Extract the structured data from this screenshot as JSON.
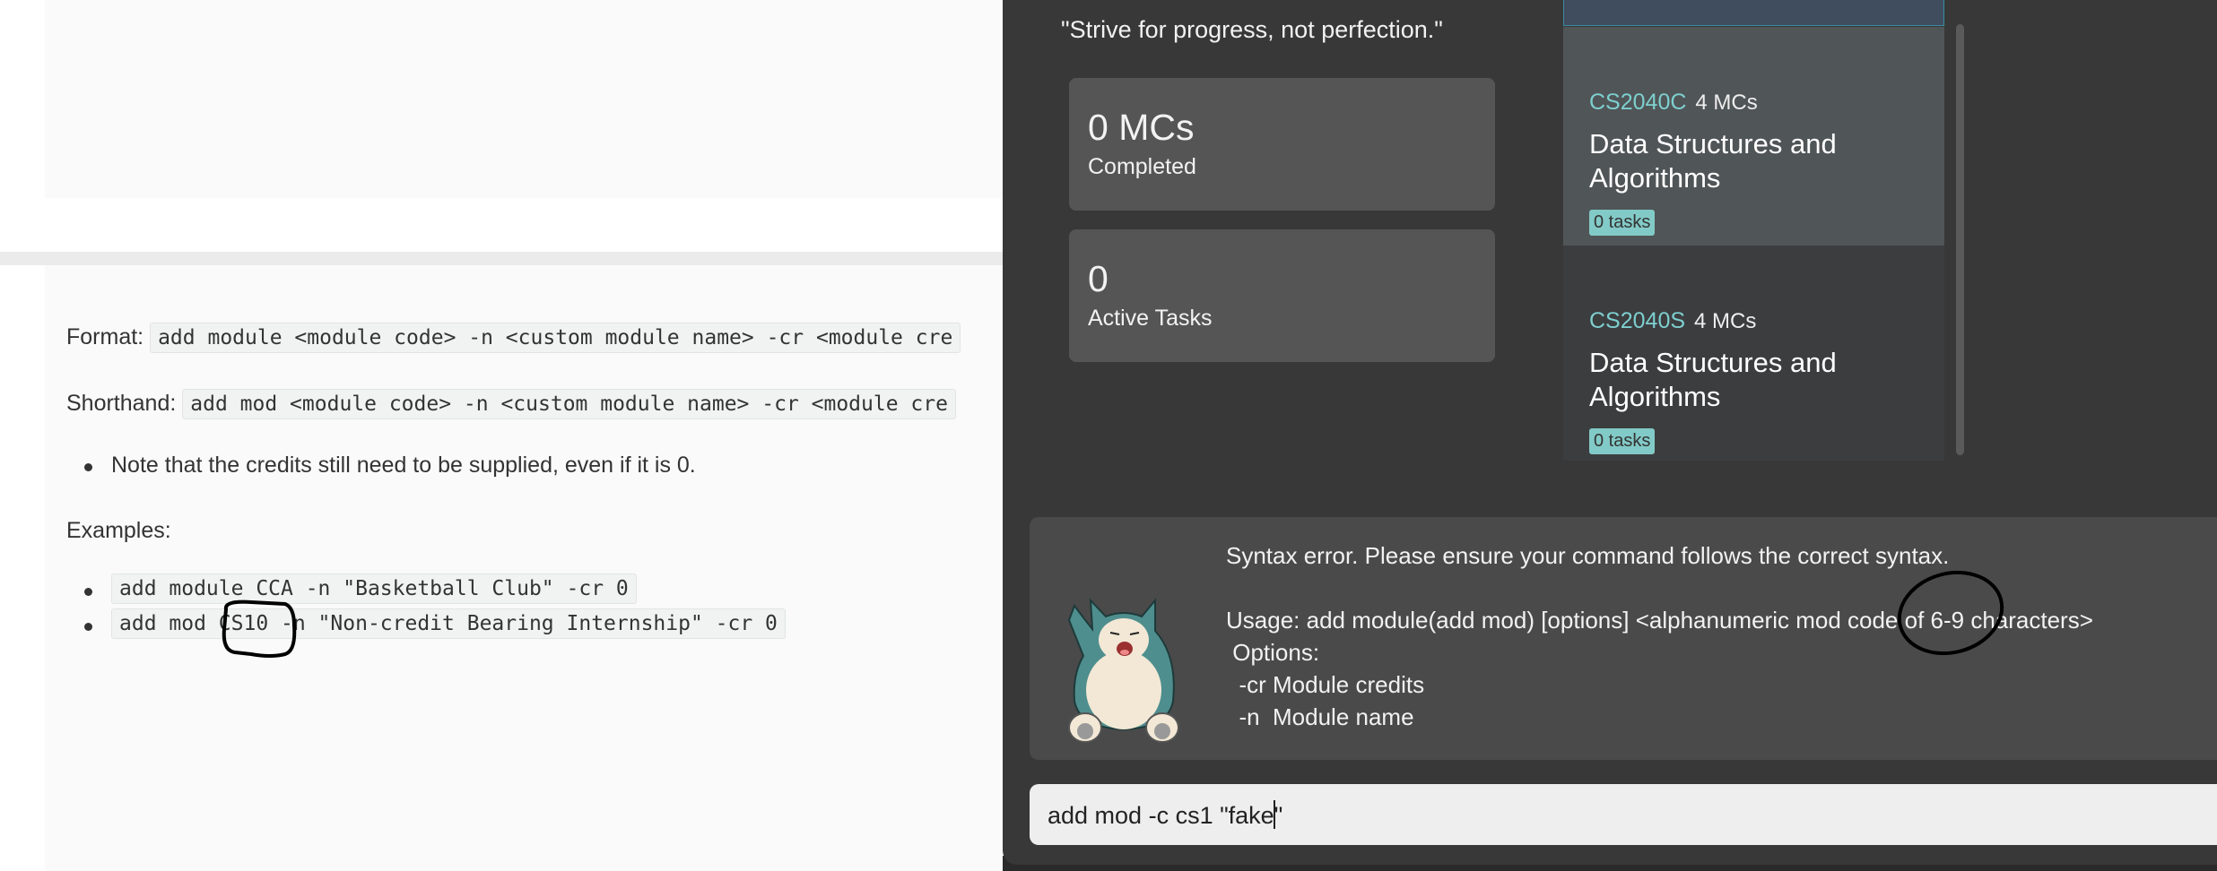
{
  "doc": {
    "format_label": "Format:",
    "format_code": "add module <module code> -n <custom module name> -cr <module cre",
    "shorthand_label": "Shorthand:",
    "shorthand_code": "add mod <module code> -n <custom module name> -cr <module cre",
    "note": "Note that the credits still need to be supplied, even if it is 0.",
    "examples_label": "Examples:",
    "examples": [
      "add module CCA -n \"Basketball Club\" -cr 0",
      "add mod CS10 -n \"Non-credit Bearing Internship\" -cr 0"
    ]
  },
  "app": {
    "quote": "\"Strive for progress, not perfection.\"",
    "stats": [
      {
        "value": "0 MCs",
        "label": "Completed"
      },
      {
        "value": "0",
        "label": "Active Tasks"
      }
    ],
    "modules": [
      {
        "code": "CS2040C",
        "credits": "4 MCs",
        "name": "Data Structures and Algorithms",
        "tasks": "0 tasks"
      },
      {
        "code": "CS2040S",
        "credits": "4 MCs",
        "name": "Data Structures and Algorithms",
        "tasks": "0 tasks"
      }
    ],
    "result": {
      "error": "Syntax error. Please ensure your command follows the correct syntax.",
      "usage": "Usage: add module(add mod) [options] <alphanumeric mod code of 6-9 characters>",
      "options_label": " Options:",
      "option_cr": "  -cr Module credits",
      "option_n": "  -n  Module name"
    },
    "command_before_caret": "add mod -c cs1 \"fake",
    "command_after_caret": "\"",
    "colors": {
      "background": "#383838",
      "module_code": "#7ecfcf",
      "badge": "#82cac7",
      "selected": "#404d5e"
    }
  }
}
